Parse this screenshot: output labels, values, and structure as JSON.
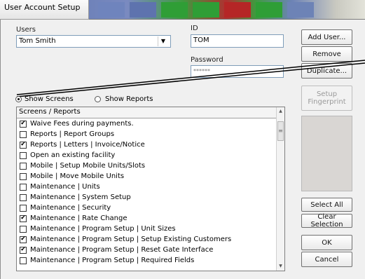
{
  "window": {
    "title": "User Account Setup"
  },
  "users": {
    "label": "Users",
    "selected": "Tom Smith"
  },
  "id_field": {
    "label": "ID",
    "value": "TOM"
  },
  "password_field": {
    "label": "Password",
    "value": "******"
  },
  "buttons": {
    "add_user": "Add User...",
    "remove": "Remove",
    "duplicate": "Duplicate...",
    "setup_fingerprint": "Setup\nFingerprint",
    "select_all": "Select All",
    "clear_selection": "Clear Selection",
    "ok": "OK",
    "cancel": "Cancel"
  },
  "view_options": {
    "show_screens": "Show Screens",
    "show_reports": "Show Reports",
    "selected": "show_screens"
  },
  "list": {
    "header": "Screens / Reports",
    "items": [
      {
        "label": "Waive Fees during payments.",
        "checked": true
      },
      {
        "label": "Reports | Report Groups",
        "checked": false
      },
      {
        "label": "Reports | Letters | Invoice/Notice",
        "checked": true
      },
      {
        "label": "Open an existing facility",
        "checked": false
      },
      {
        "label": "Mobile | Setup Mobile Units/Slots",
        "checked": false
      },
      {
        "label": "Mobile | Move Mobile Units",
        "checked": false
      },
      {
        "label": "Maintenance | Units",
        "checked": false
      },
      {
        "label": "Maintenance | System Setup",
        "checked": false
      },
      {
        "label": "Maintenance | Security",
        "checked": false
      },
      {
        "label": "Maintenance | Rate Change",
        "checked": true
      },
      {
        "label": "Maintenance | Program Setup | Unit Sizes",
        "checked": false
      },
      {
        "label": "Maintenance | Program Setup | Setup Existing Customers",
        "checked": true
      },
      {
        "label": "Maintenance | Program Setup | Reset Gate Interface",
        "checked": true
      },
      {
        "label": "Maintenance | Program Setup | Required Fields",
        "checked": false
      }
    ]
  },
  "glyphs": {
    "dropdown": "▼",
    "check": "✔",
    "scroll_up": "▲",
    "scroll_down": "▼",
    "grip": "≡"
  }
}
